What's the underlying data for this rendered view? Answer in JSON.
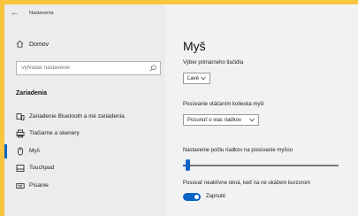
{
  "app": {
    "title": "Nastavenia"
  },
  "sidebar": {
    "home_label": "Domov",
    "search": {
      "placeholder": "Vyhľadať nastavenie"
    },
    "section_title": "Zariadenia",
    "items": [
      {
        "label": "Zariadenie Bluetooth a iné zariadenia",
        "icon": "bluetooth-devices-icon"
      },
      {
        "label": "Tlačiarne a skenery",
        "icon": "printer-icon"
      },
      {
        "label": "Myš",
        "icon": "mouse-icon"
      },
      {
        "label": "Touchpad",
        "icon": "touchpad-icon"
      },
      {
        "label": "Písanie",
        "icon": "keyboard-icon"
      }
    ],
    "active_index": 2
  },
  "main": {
    "title": "Myš",
    "primary_button": {
      "label": "Výber primárneho tlačidla",
      "value": "Ľavé"
    },
    "wheel_scroll": {
      "label": "Posúvanie otáčaním kolieska myši",
      "value": "Posunúť o viac riadkov"
    },
    "lines_to_scroll": {
      "label": "Nastavenie počtu riadkov na posúvanie myšou",
      "level": 0.03
    },
    "inactive_scroll": {
      "label": "Posúvať neaktívne okná, keď na ne ukážem kurzorom",
      "state": "Zapnuté",
      "on": true
    }
  },
  "colors": {
    "accent": "#0a64c8",
    "frame": "#f7c53f",
    "sidebar_bg": "#ececec",
    "main_bg": "#f2f2f2"
  }
}
